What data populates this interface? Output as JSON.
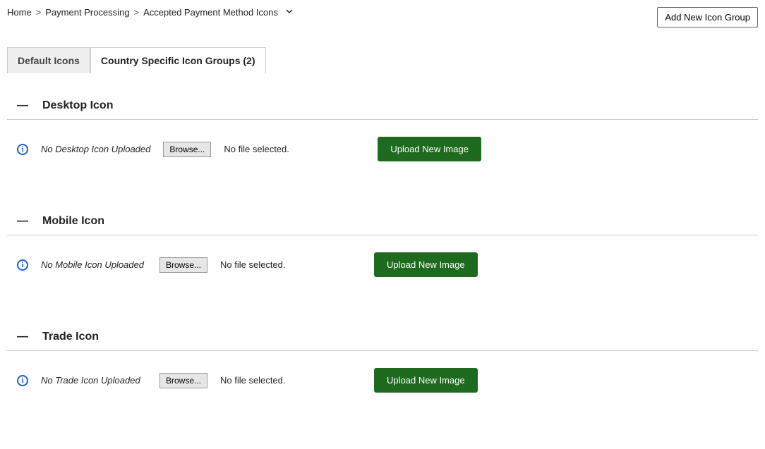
{
  "breadcrumb": {
    "home": "Home",
    "payment": "Payment Processing",
    "current": "Accepted Payment Method Icons"
  },
  "add_button": "Add New Icon Group",
  "tabs": {
    "default": "Default Icons",
    "country": "Country Specific Icon Groups (2)"
  },
  "sections": [
    {
      "title": "Desktop Icon",
      "status": "No Desktop Icon Uploaded",
      "browse": "Browse...",
      "file_status": "No file selected.",
      "upload": "Upload New Image"
    },
    {
      "title": "Mobile Icon",
      "status": "No Mobile Icon Uploaded",
      "browse": "Browse...",
      "file_status": "No file selected.",
      "upload": "Upload New Image"
    },
    {
      "title": "Trade Icon",
      "status": "No Trade Icon Uploaded",
      "browse": "Browse...",
      "file_status": "No file selected.",
      "upload": "Upload New Image"
    }
  ]
}
